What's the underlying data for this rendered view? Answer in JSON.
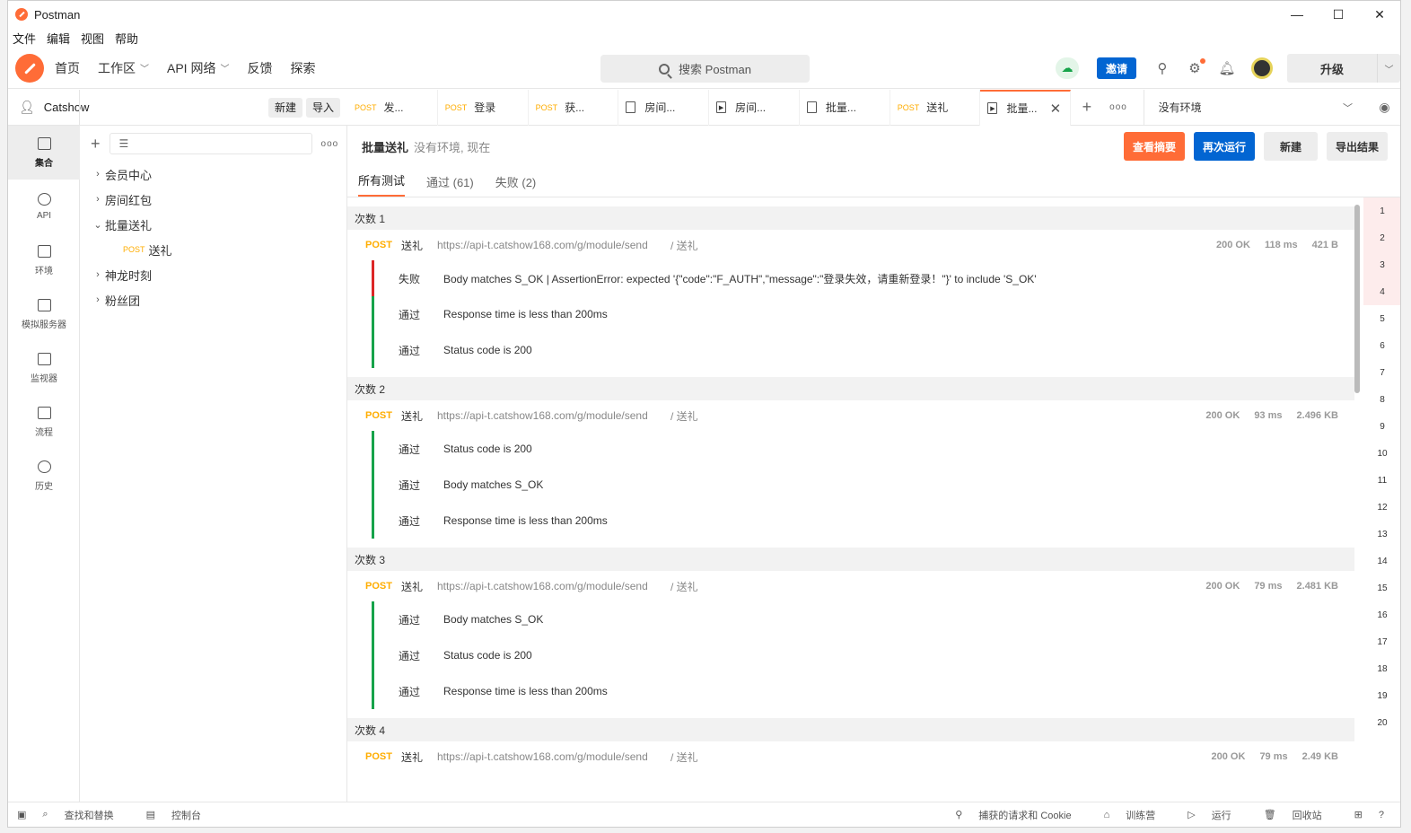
{
  "window": {
    "title": "Postman",
    "min": "—",
    "max": "☐",
    "close": "✕"
  },
  "menu": [
    "文件",
    "编辑",
    "视图",
    "帮助"
  ],
  "header": {
    "nav": [
      {
        "label": "首页",
        "chev": false
      },
      {
        "label": "工作区",
        "chev": true
      },
      {
        "label": "API 网络",
        "chev": true
      },
      {
        "label": "反馈",
        "chev": false
      },
      {
        "label": "探索",
        "chev": false
      }
    ],
    "search_placeholder": "搜索 Postman",
    "invite": "邀请",
    "upgrade": "升级"
  },
  "sidebar": {
    "workspace": "Catshow",
    "new_btn": "新建",
    "import_btn": "导入",
    "rail": [
      {
        "label": "集合",
        "icon": "collections-icon",
        "active": true
      },
      {
        "label": "API",
        "icon": "api-icon",
        "active": false
      },
      {
        "label": "环境",
        "icon": "environment-icon",
        "active": false
      },
      {
        "label": "模拟服务器",
        "icon": "mock-server-icon",
        "active": false
      },
      {
        "label": "监视器",
        "icon": "monitor-icon",
        "active": false
      },
      {
        "label": "流程",
        "icon": "flow-icon",
        "active": false
      },
      {
        "label": "历史",
        "icon": "history-icon",
        "active": false
      }
    ],
    "tree": [
      {
        "label": "会员中心",
        "expanded": false
      },
      {
        "label": "房间红包",
        "expanded": false
      },
      {
        "label": "批量送礼",
        "expanded": true,
        "children": [
          {
            "method": "POST",
            "label": "送礼"
          }
        ]
      },
      {
        "label": "神龙时刻",
        "expanded": false
      },
      {
        "label": "粉丝团",
        "expanded": false
      }
    ]
  },
  "tabs": [
    {
      "method": "POST",
      "label": "发...",
      "type": "request"
    },
    {
      "method": "POST",
      "label": "登录",
      "type": "request"
    },
    {
      "method": "POST",
      "label": "获...",
      "type": "request"
    },
    {
      "method": "",
      "label": "房间...",
      "type": "collection"
    },
    {
      "method": "",
      "label": "房间...",
      "type": "runner"
    },
    {
      "method": "",
      "label": "批量...",
      "type": "collection"
    },
    {
      "method": "POST",
      "label": "送礼",
      "type": "request"
    },
    {
      "method": "",
      "label": "批量...",
      "type": "runner",
      "active": true
    }
  ],
  "env": {
    "label": "没有环境"
  },
  "run": {
    "title": "批量送礼",
    "subtitle": "没有环境, 现在",
    "actions": {
      "summary": "查看摘要",
      "rerun": "再次运行",
      "new": "新建",
      "export": "导出结果"
    },
    "filters": {
      "all": "所有测试",
      "passed": "通过 (61)",
      "failed": "失败 (2)"
    }
  },
  "iterations": [
    {
      "label": "次数 1",
      "method": "POST",
      "name": "送礼",
      "url": "https://api-t.catshow168.com/g/module/send",
      "path": "/ 送礼",
      "status": "200 OK",
      "time": "118 ms",
      "size": "421 B",
      "tests": [
        {
          "status": "失败",
          "pass": false,
          "name": "Body matches S_OK | AssertionError: expected '{\"code\":\"F_AUTH\",\"message\":\"登录失效，请重新登录！\"}' to include 'S_OK'"
        },
        {
          "status": "通过",
          "pass": true,
          "name": "Response time is less than 200ms"
        },
        {
          "status": "通过",
          "pass": true,
          "name": "Status code is 200"
        }
      ]
    },
    {
      "label": "次数 2",
      "method": "POST",
      "name": "送礼",
      "url": "https://api-t.catshow168.com/g/module/send",
      "path": "/ 送礼",
      "status": "200 OK",
      "time": "93 ms",
      "size": "2.496 KB",
      "tests": [
        {
          "status": "通过",
          "pass": true,
          "name": "Status code is 200"
        },
        {
          "status": "通过",
          "pass": true,
          "name": "Body matches S_OK"
        },
        {
          "status": "通过",
          "pass": true,
          "name": "Response time is less than 200ms"
        }
      ]
    },
    {
      "label": "次数 3",
      "method": "POST",
      "name": "送礼",
      "url": "https://api-t.catshow168.com/g/module/send",
      "path": "/ 送礼",
      "status": "200 OK",
      "time": "79 ms",
      "size": "2.481 KB",
      "tests": [
        {
          "status": "通过",
          "pass": true,
          "name": "Body matches S_OK"
        },
        {
          "status": "通过",
          "pass": true,
          "name": "Status code is 200"
        },
        {
          "status": "通过",
          "pass": true,
          "name": "Response time is less than 200ms"
        }
      ]
    },
    {
      "label": "次数 4",
      "method": "POST",
      "name": "送礼",
      "url": "https://api-t.catshow168.com/g/module/send",
      "path": "/ 送礼",
      "status": "200 OK",
      "time": "79 ms",
      "size": "2.49 KB",
      "tests": []
    }
  ],
  "row_index": [
    "1",
    "2",
    "3",
    "4",
    "5",
    "6",
    "7",
    "8",
    "9",
    "10",
    "11",
    "12",
    "13",
    "14",
    "15",
    "16",
    "17",
    "18",
    "19",
    "20"
  ],
  "row_index_failed": [
    "1",
    "2",
    "3",
    "4"
  ],
  "statusbar": {
    "find_replace": "查找和替换",
    "console": "控制台",
    "capture": "捕获的请求和 Cookie",
    "bootcamp": "训练营",
    "runner": "运行",
    "trash": "回收站"
  },
  "colors": {
    "brand": "#ff6c37",
    "primary": "#0265d2",
    "pass": "#16a34a",
    "fail": "#dc2626",
    "post": "#ffad00"
  }
}
